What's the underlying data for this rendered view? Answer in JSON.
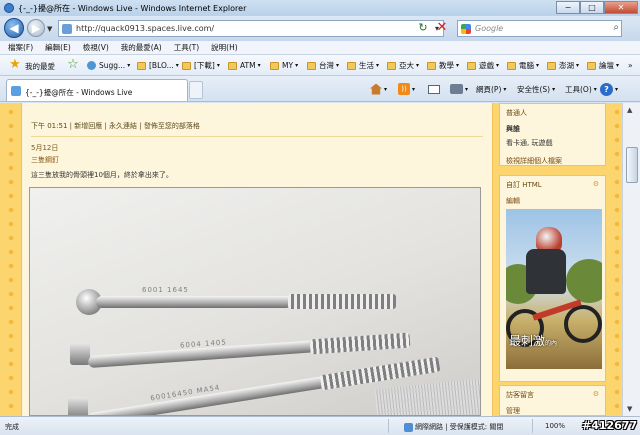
{
  "window": {
    "title": "{-_-}擾@所在 - Windows Live - Windows Internet Explorer",
    "buttons": [
      "−",
      "□",
      "✕"
    ]
  },
  "nav": {
    "back_glyph": "◀",
    "forward_glyph": "▶",
    "history_glyph": "▼",
    "url": "http://quack0913.spaces.live.com/",
    "dropdown_glyph": "▾",
    "refresh_glyph": "↻",
    "stop_glyph": "✕",
    "search_placeholder": "Google",
    "search_glyph": "⌕"
  },
  "menu": [
    "檔案(F)",
    "編輯(E)",
    "檢視(V)",
    "我的最愛(A)",
    "工具(T)",
    "說明(H)"
  ],
  "favorites": {
    "star_glyph": "★",
    "add_glyph": "☆",
    "label": "我的最愛",
    "caret": "▾",
    "items": [
      "Sugg...",
      "[BLO...",
      "[下載]",
      "ATM",
      "MY",
      "台灣",
      "生活",
      "亞大",
      "教學",
      "遊戲",
      "電腦",
      "澎湖",
      "論壇"
    ],
    "more": "»"
  },
  "tab": {
    "title": "{-_-}擾@所在 - Windows Live",
    "rss_glyph": "))",
    "help_glyph": "?",
    "commands": [
      "網頁(P)",
      "安全性(S)",
      "工具(O)"
    ]
  },
  "blog": {
    "post_header": "下午 01:51 | 新增回應 | 永久連結 | 發佈至您的部落格",
    "date": "5月12日",
    "title": "三隻鋼釘",
    "body": "這三隻放我的骨頭裡10個月，終於拿出來了。",
    "photo_engrave_1": "6001 1645",
    "photo_engrave_2": "6004 1405",
    "photo_engrave_3": "60016450 MA54"
  },
  "sidebar": {
    "profile_title": "普通人",
    "profile_name": "與誰",
    "profile_desc": "看卡通, 玩遊戲",
    "profile_link": "檢視詳細個人檔案",
    "html_title": "自訂 HTML",
    "html_edit": "編輯",
    "gear_glyph": "⚙",
    "image_caption_main": "最刺激",
    "image_caption_sub": "的內",
    "guest_title": "訪客留言",
    "guest_manage": "管理"
  },
  "scrollbar": {
    "up": "▲",
    "down": "▼"
  },
  "status": {
    "text": "完成",
    "zone": "網際網路 | 受保護模式: 關閉",
    "zoom": "100%",
    "watermark": "#412677"
  }
}
